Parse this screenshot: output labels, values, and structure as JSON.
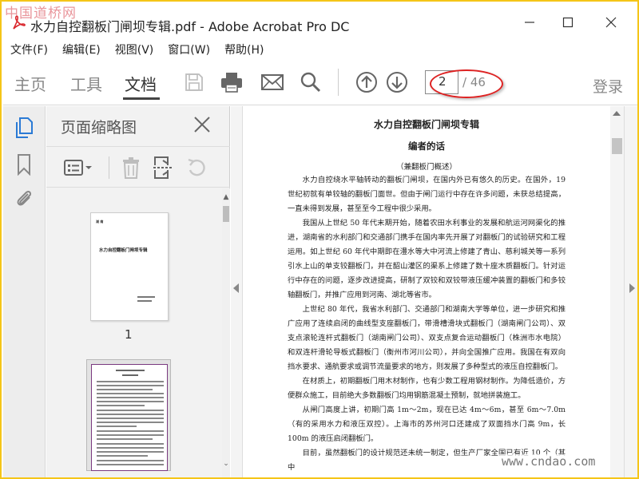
{
  "watermark_top": "中国道桥网",
  "watermark_bottom": "www.cndao.com",
  "window": {
    "title": "水力自控翻板门闸坝专辑.pdf - Adobe Acrobat Pro DC"
  },
  "menu": [
    "文件(F)",
    "编辑(E)",
    "视图(V)",
    "窗口(W)",
    "帮助(H)"
  ],
  "toolbar": {
    "tabs": [
      "主页",
      "工具",
      "文档"
    ],
    "active_tab": "文档",
    "current_page": "2",
    "page_total": "/ 46",
    "login": "登录",
    "icons": [
      "save-icon",
      "print-icon",
      "email-icon",
      "search-icon",
      "page-up-icon",
      "page-down-icon"
    ]
  },
  "left_strip": {
    "icons": [
      "page-thumbnails-icon",
      "bookmark-icon",
      "attachment-icon"
    ]
  },
  "thumbnails": {
    "header": "页面缩略图",
    "page1_number": "1",
    "page1_title": "水力自控翻板门闸坝专辑",
    "tools": [
      "thumbnail-options-icon",
      "delete-icon",
      "extract-pages-icon",
      "rotate-icon"
    ]
  },
  "document": {
    "title": "水力自控翻板门闸坝专辑",
    "subtitle": "编者的话",
    "section": "（兼翻板门概述）",
    "paragraphs": [
      "水力自控绕水平轴转动的翻板门闸坝，在国内外已有悠久的历史。在国外，19 世纪初就有单铰轴的翻板门面世。但由于闸门运行中存在许多问题，未获总结提高，一直未得到发展，甚至至今工程中很少采用。",
      "我国从上世纪 50 年代末期开始，随着农田水利事业的发展和航运河网渠化的推进，湖南省的水利部门和交通部门携手在国内率先开展了对翻板门的试验研究和工程运用。如上世纪 60 年代中期即在澧水等大中河流上修建了青山、慈利城关等一系列引水上山的单支铰翻板门，并在韶山灌区的渠系上修建了数十座木质翻板门。针对运行中存在的问题，逐步改进提高，研制了双铰和双铰带液压缓冲装置的翻板门和多铰轴翻板门，并推广应用到河南、湖北等省市。",
      "上世纪 80 年代，我省水利部门、交通部门和湖南大学等单位，进一步研究和推广应用了连续启闭的曲线型支座翻板门，带滑槽滑块式翻板门（湖南闸门公司）、双支点滚轮连杆式翻板门（湖南闸门公司）、双支点复合运动翻板门（株洲市水电院）和双连杆滑轮导板式翻板门（衡州市河川公司），并向全国推广应用。我国在有双向挡水要求、通航要求或调节流量要求的地方，则发展了多种型式的液压自控翻板门。",
      "在材质上，初期翻板门用木材制作，也有少数工程用钢材制作。为降低造价，方便群众施工，目前绝大多数翻板门均用钢筋混凝土预制，就地拼装施工。",
      "从闸门高度上讲，初期门高 1m～2m，现在已达 4m～6m，甚至 6m～7.0m（有的采用水力和液压双控）。上海市的苏州河口还建成了双面挡水门高 9m，长 100m 的液压启闭翻板门。",
      "目前，虽然翻板门的设计规范还未统一制定，但生产厂家全国已有近 10 个（其中"
    ]
  },
  "colors": {
    "accent_border": "#f5c518",
    "annotation_red": "#dd2222",
    "acrobat_red": "#d9262c",
    "icon_blue": "#2a7ad5",
    "icon_gray": "#666666"
  }
}
